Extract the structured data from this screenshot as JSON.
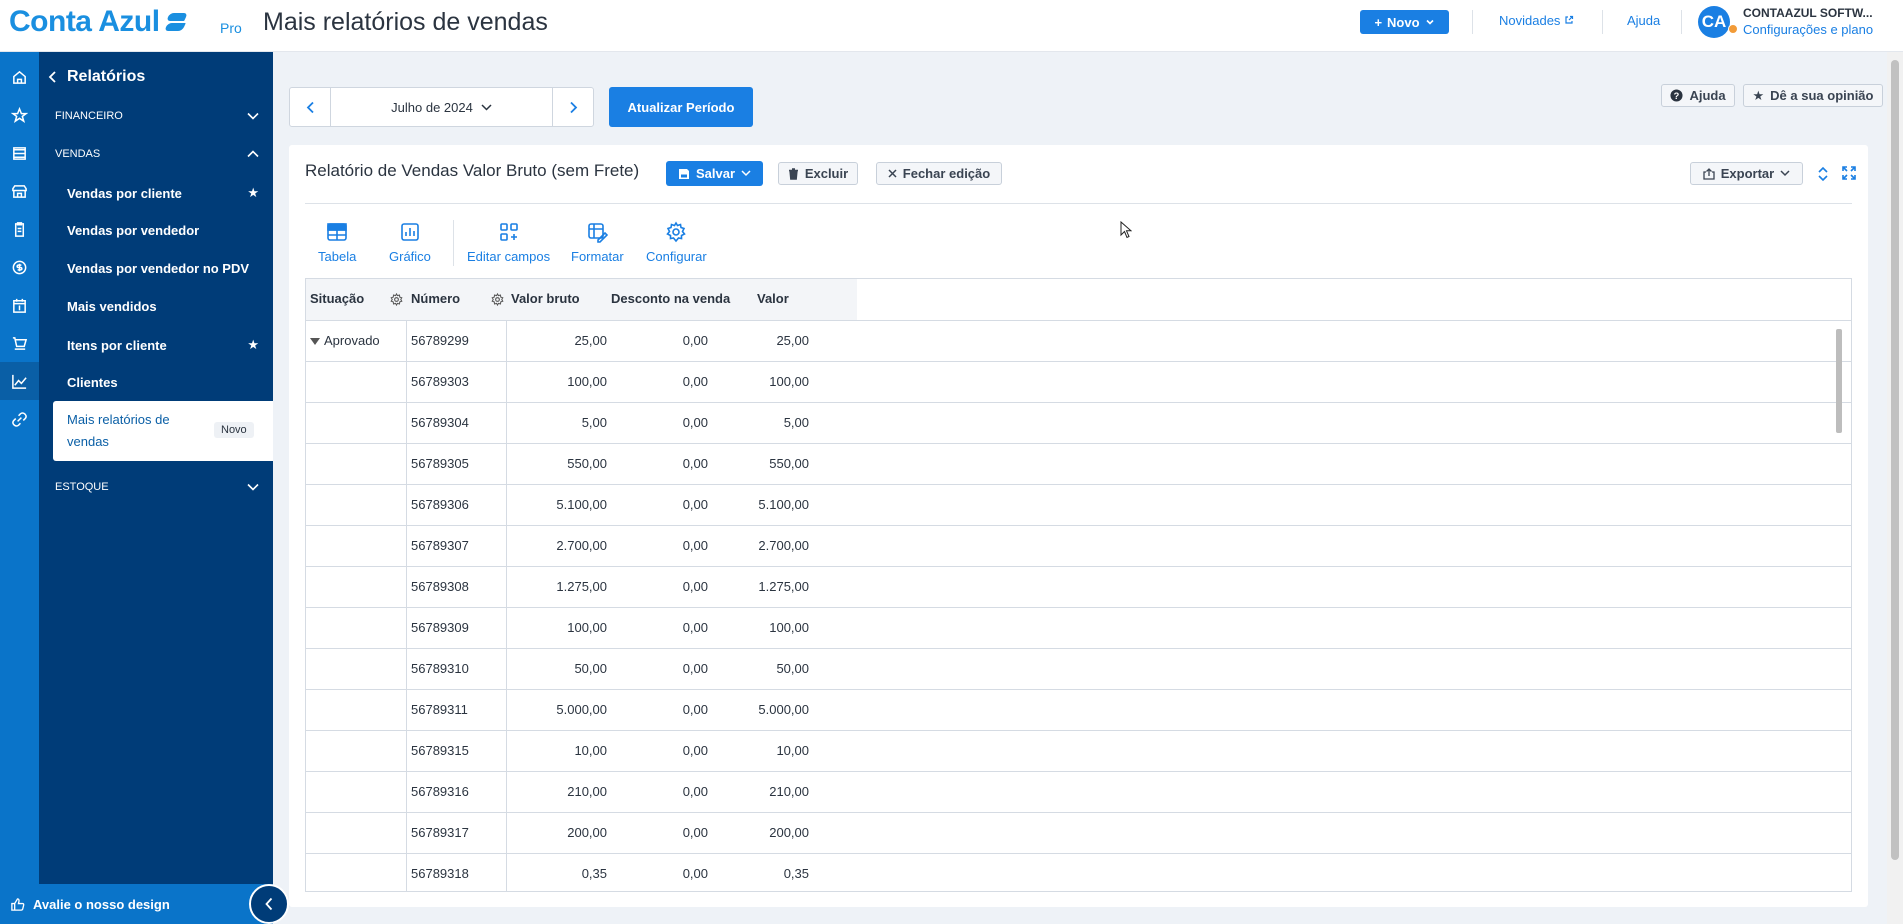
{
  "header": {
    "brand": "Conta Azul",
    "plan": "Pro",
    "title": "Mais relatórios de vendas",
    "new_button": "Novo",
    "novidades": "Novidades",
    "help": "Ajuda",
    "avatar_initials": "CA",
    "company_name": "CONTAAZUL SOFTW...",
    "company_link": "Configurações e plano"
  },
  "sidebar": {
    "back_title": "Relatórios",
    "sections": [
      {
        "label": "FINANCEIRO"
      },
      {
        "label": "VENDAS"
      },
      {
        "label": "ESTOQUE"
      }
    ],
    "items": [
      {
        "label": "Vendas por cliente",
        "starred": true
      },
      {
        "label": "Vendas por vendedor",
        "starred": false
      },
      {
        "label": "Vendas por vendedor no PDV",
        "starred": false
      },
      {
        "label": "Mais vendidos",
        "starred": false
      },
      {
        "label": "Itens por cliente",
        "starred": true
      },
      {
        "label": "Clientes",
        "starred": false
      }
    ],
    "active_item": {
      "label": "Mais relatórios de vendas",
      "badge": "Novo"
    },
    "footer": "Avalie o nosso design"
  },
  "toolbar": {
    "period": "Julho de 2024",
    "refresh": "Atualizar Período",
    "help": "Ajuda",
    "feedback": "Dê a sua opinião"
  },
  "report": {
    "title": "Relatório de Vendas Valor Bruto (sem Frete)",
    "save": "Salvar",
    "delete": "Excluir",
    "close_edit": "Fechar edição",
    "export": "Exportar",
    "tools": [
      "Tabela",
      "Gráfico",
      "Editar campos",
      "Formatar",
      "Configurar"
    ]
  },
  "table": {
    "columns": [
      "Situação",
      "Número",
      "Valor bruto",
      "Desconto na venda",
      "Valor"
    ],
    "group_label": "Aprovado",
    "rows": [
      {
        "numero": "56789299",
        "bruto": "25,00",
        "desconto": "0,00",
        "valor": "25,00"
      },
      {
        "numero": "56789303",
        "bruto": "100,00",
        "desconto": "0,00",
        "valor": "100,00"
      },
      {
        "numero": "56789304",
        "bruto": "5,00",
        "desconto": "0,00",
        "valor": "5,00"
      },
      {
        "numero": "56789305",
        "bruto": "550,00",
        "desconto": "0,00",
        "valor": "550,00"
      },
      {
        "numero": "56789306",
        "bruto": "5.100,00",
        "desconto": "0,00",
        "valor": "5.100,00"
      },
      {
        "numero": "56789307",
        "bruto": "2.700,00",
        "desconto": "0,00",
        "valor": "2.700,00"
      },
      {
        "numero": "56789308",
        "bruto": "1.275,00",
        "desconto": "0,00",
        "valor": "1.275,00"
      },
      {
        "numero": "56789309",
        "bruto": "100,00",
        "desconto": "0,00",
        "valor": "100,00"
      },
      {
        "numero": "56789310",
        "bruto": "50,00",
        "desconto": "0,00",
        "valor": "50,00"
      },
      {
        "numero": "56789311",
        "bruto": "5.000,00",
        "desconto": "0,00",
        "valor": "5.000,00"
      },
      {
        "numero": "56789315",
        "bruto": "10,00",
        "desconto": "0,00",
        "valor": "10,00"
      },
      {
        "numero": "56789316",
        "bruto": "210,00",
        "desconto": "0,00",
        "valor": "210,00"
      },
      {
        "numero": "56789317",
        "bruto": "200,00",
        "desconto": "0,00",
        "valor": "200,00"
      },
      {
        "numero": "56789318",
        "bruto": "0,35",
        "desconto": "0,00",
        "valor": "0,35"
      }
    ]
  },
  "colors": {
    "accent": "#1a7fe3",
    "sidebar": "#003c78",
    "rail": "#0a74c9"
  }
}
